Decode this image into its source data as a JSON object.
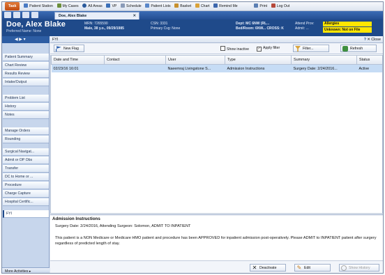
{
  "menubar": {
    "app_button": "Task",
    "items": [
      "Patient Station",
      "My Cases",
      "All Areas",
      "VP",
      "Schedule",
      "Patient Lists",
      "Basket",
      "Chart",
      "Remind Me"
    ],
    "right_items": [
      "Print",
      "Log Out"
    ]
  },
  "tabbar": {
    "doc_tab_label": "Doe, Alex Blake"
  },
  "banner": {
    "patient_name": "Doe, Alex Blake",
    "preferred_name": "Preferred Name: None",
    "col1": [
      "MRN: 7265590",
      "Male, 38 y.o., 09/29/1985"
    ],
    "col2": [
      "CSN: 3331",
      "Primary Cvg: None"
    ],
    "col3": [
      "Dept: MC 6NW (RL...",
      "Bed/Room: 6NW...  CROSS: K"
    ],
    "col4": [
      "Attend Prov:",
      "Admit: ..."
    ],
    "allergy_label": "Allergies",
    "allergy_value": "Unknown: Not on File"
  },
  "sidebar": {
    "items": [
      "Patient Summary",
      "Chart Review",
      "Results Review",
      "Intake/Output",
      "Problem List",
      "History",
      "Notes",
      "Manage Orders",
      "Rounding",
      "Surgical Navigat...",
      "Admit or OP Obs",
      "Transfer",
      "DC to Home or ...",
      "Procedure",
      "Charge Capture",
      "Hospital Certific...",
      "FYI"
    ],
    "more_activities": "More Activities"
  },
  "main": {
    "header_title": "FYI",
    "help": "?",
    "close": "Close"
  },
  "toolbar": {
    "new_flag": "New Flag",
    "show_inactive": "Show inactive",
    "apply_filter": "Apply filter",
    "filter": "Filter...",
    "refresh": "Refresh"
  },
  "table": {
    "columns": [
      "Date and Time",
      "Contact",
      "User",
      "Type",
      "Summary",
      "Status"
    ],
    "rows": [
      {
        "date": "02/23/16 16:01",
        "contact": "",
        "user": "Naeemraj Livingstone S...",
        "type": "Admission Instructions",
        "summary": "Surgery Date: 2/24/2016...",
        "status": "Active"
      }
    ]
  },
  "detail": {
    "title": "Admission Instructions",
    "line1": "Surgery Date: 2/24/2016, Attending Surgeon: Solomon, ADMIT TO INPATIENT",
    "line2": "This patient is a NON Medicare or Medicare HMO patient and procedure has been APPROVED for inpatient admission post-operatively. Please ADMIT to INPATIENT patient after surgery regardless of predicted length of stay."
  },
  "bottom": {
    "deactivate": "Deactivate",
    "edit": "Edit",
    "show_history": "Show History"
  },
  "colors": {
    "banner_bg": "#1f4a8a",
    "allergy_bg": "#ffe600",
    "selected_row": "#c6dcf5",
    "app_button": "#d15a1c"
  }
}
